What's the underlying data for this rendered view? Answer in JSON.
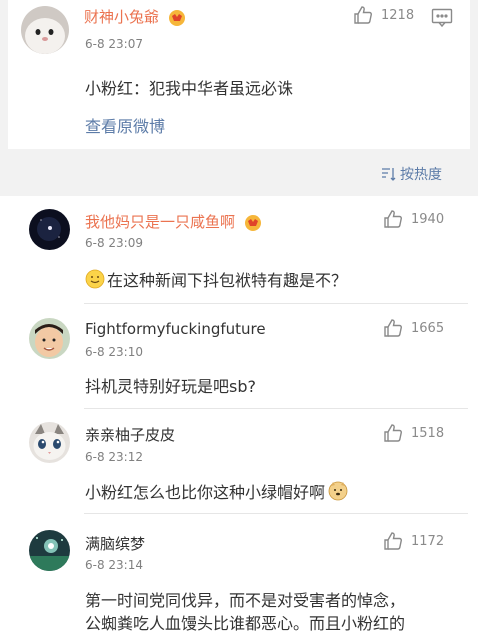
{
  "top_comment": {
    "username": "财神小兔爺",
    "time": "6-8 23:07",
    "text": "小粉红：犯我中华者虽远必诛",
    "likes": "1218",
    "view_original": "查看原微博",
    "icons": [
      "thumb-up-icon",
      "comment-icon",
      "vip-badge-icon"
    ]
  },
  "sort": {
    "label": "按热度",
    "icon": "sort-icon"
  },
  "comments": [
    {
      "username": "我他妈只是一只咸鱼啊",
      "time": "6-8 23:09",
      "text": "在这种新闻下抖包袱特有趣是不？",
      "likes": "1940",
      "name_color": "#eb7350"
    },
    {
      "username": "Fightformyfuckingfuture",
      "time": "6-8 23:10",
      "text": "抖机灵特别好玩是吧sb?",
      "likes": "1665",
      "name_color": "#333333"
    },
    {
      "username": "亲亲柚子皮皮",
      "time": "6-8 23:12",
      "text": "小粉红怎么也比你这种小绿帽好啊",
      "likes": "1518",
      "name_color": "#333333"
    },
    {
      "username": "满脑缤梦",
      "time": "6-8 23:14",
      "text_line1": "第一时间党同伐异，而不是对受害者的悼念，",
      "text_line2": "公蜘粪吃人血馒头比谁都恶心。而且小粉红的",
      "likes": "1172",
      "name_color": "#333333"
    }
  ]
}
